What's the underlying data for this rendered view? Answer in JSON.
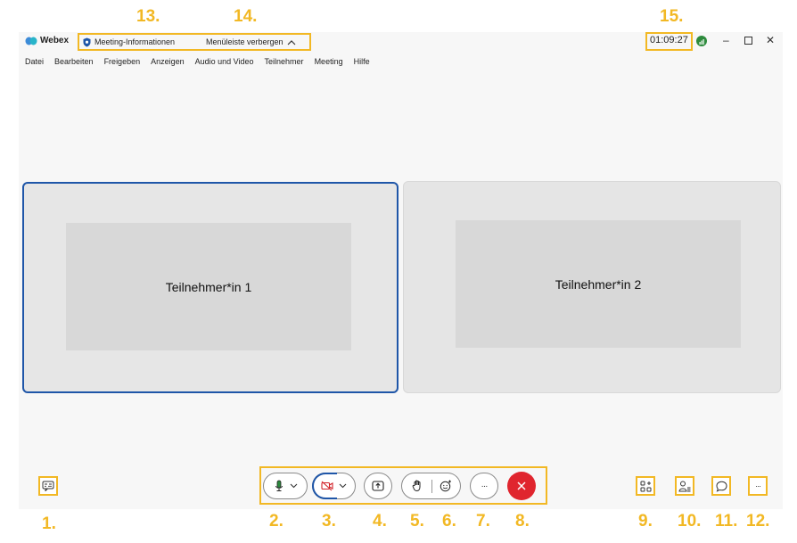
{
  "annotations": {
    "n1": "1.",
    "n2": "2.",
    "n3": "3.",
    "n4": "4.",
    "n5": "5.",
    "n6": "6.",
    "n7": "7.",
    "n8": "8.",
    "n9": "9.",
    "n10": "10.",
    "n11": "11.",
    "n12": "12.",
    "n13": "13.",
    "n14": "14.",
    "n15": "15."
  },
  "titlebar": {
    "app_name": "Webex",
    "meeting_info": "Meeting-Informationen",
    "hide_menu": "Menüleiste verbergen",
    "timer": "01:09:27"
  },
  "menu": [
    "Datei",
    "Bearbeiten",
    "Freigeben",
    "Anzeigen",
    "Audio und Video",
    "Teilnehmer",
    "Meeting",
    "Hilfe"
  ],
  "participants": [
    "Teilnehmer*in 1",
    "Teilnehmer*in 2"
  ],
  "toolbar": {
    "more_label": "···"
  },
  "sidebar": {
    "more_label": "···"
  },
  "colors": {
    "highlight": "#f2b824",
    "active_border": "#1f56a8",
    "end_call": "#e0252e",
    "signal": "#2e8b3d"
  }
}
